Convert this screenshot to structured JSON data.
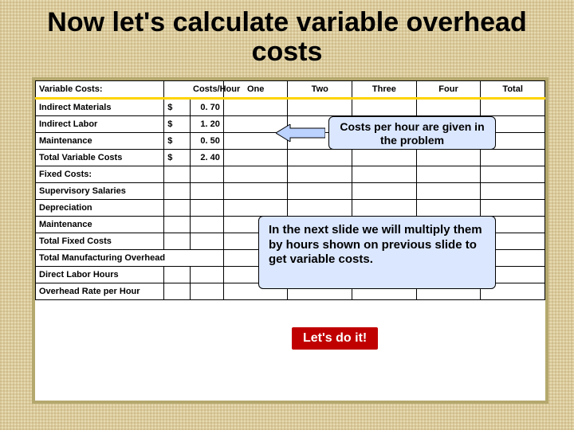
{
  "title": "Now let's calculate variable overhead costs",
  "headers": {
    "rowLabel": "Variable Costs:",
    "costsHour": "Costs/Hour",
    "q1": "One",
    "q2": "Two",
    "q3": "Three",
    "q4": "Four",
    "total": "Total"
  },
  "currencySymbol": "$",
  "variable": {
    "rows": [
      {
        "label": "Indirect Materials",
        "value": "0. 70"
      },
      {
        "label": "Indirect Labor",
        "value": "1. 20"
      },
      {
        "label": "Maintenance",
        "value": "0. 50"
      }
    ],
    "total": {
      "label": "Total Variable Costs",
      "value": "2. 40"
    }
  },
  "fixed": {
    "heading": "Fixed Costs:",
    "rows": [
      {
        "label": "Supervisory Salaries"
      },
      {
        "label": "Depreciation"
      },
      {
        "label": "Maintenance"
      }
    ],
    "total": {
      "label": "Total Fixed Costs"
    }
  },
  "footer": {
    "tmo": "Total Manufacturing Overhead",
    "dlh": "Direct Labor Hours",
    "rate": "Overhead Rate per Hour"
  },
  "callouts": {
    "costsPerHour": "Costs per hour are given in the problem",
    "nextSlide": "In the next slide we will multiply them by hours shown on previous slide to get variable costs.",
    "letsDoIt": "Let's do it!"
  }
}
